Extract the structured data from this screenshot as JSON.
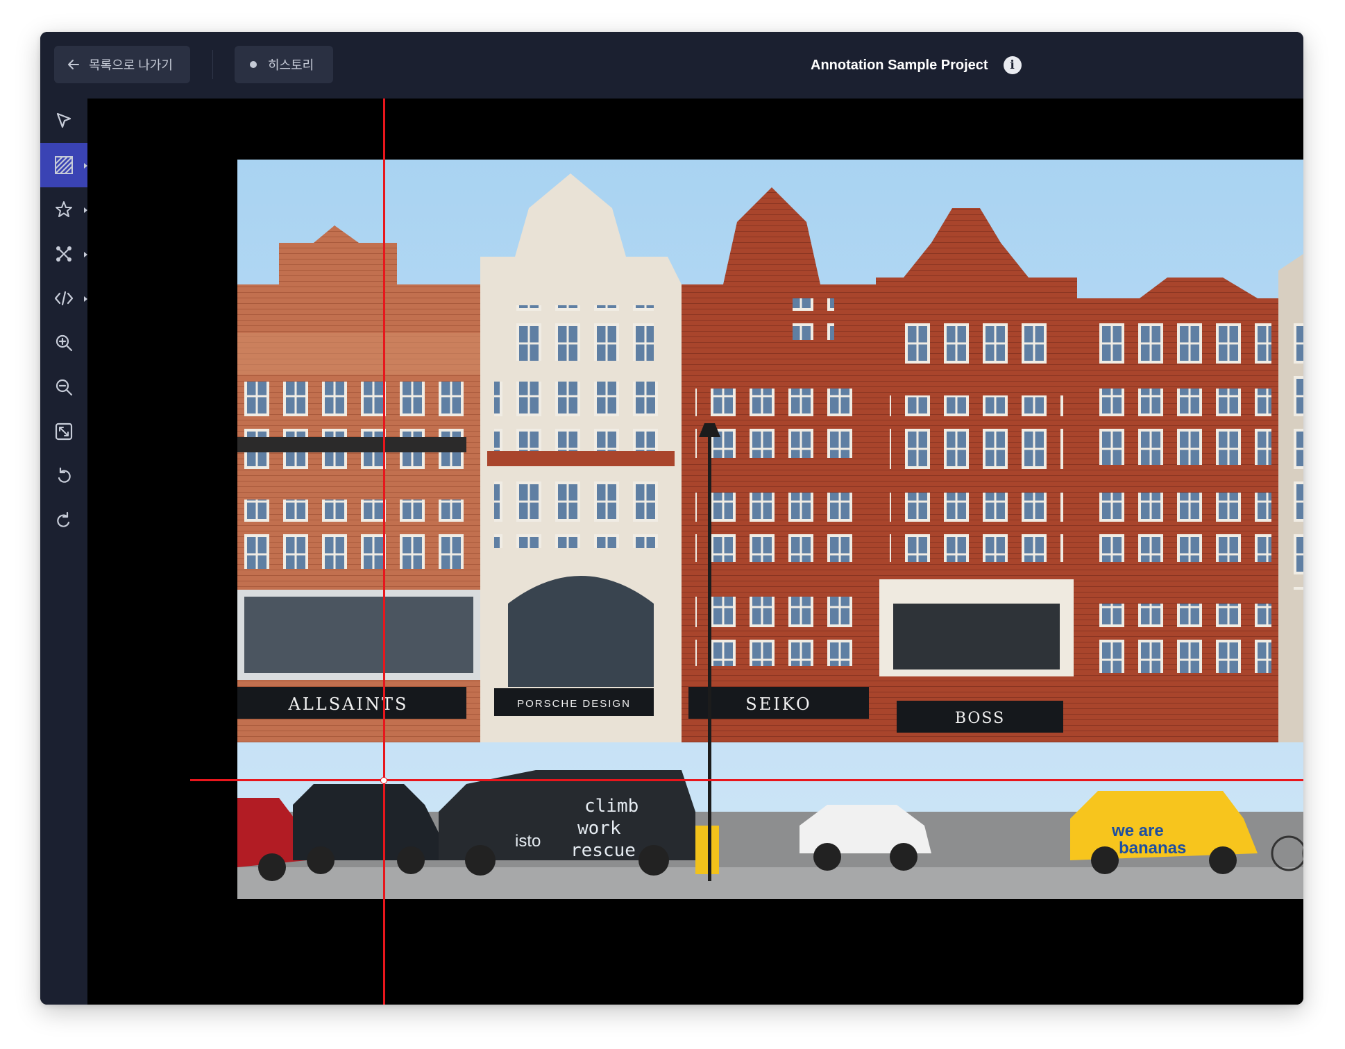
{
  "topbar": {
    "back_label": "목록으로 나가기",
    "history_label": "히스토리",
    "project_title": "Annotation Sample Project",
    "info_icon": "info-icon"
  },
  "toolbar": {
    "tools": [
      {
        "name": "select-tool",
        "icon": "cursor-arrow-icon",
        "active": false,
        "has_submenu": false
      },
      {
        "name": "area-tool",
        "icon": "hatched-box-icon",
        "active": true,
        "has_submenu": true
      },
      {
        "name": "polygon-tool",
        "icon": "star-icon",
        "active": false,
        "has_submenu": true
      },
      {
        "name": "keypoint-tool",
        "icon": "skeleton-icon",
        "active": false,
        "has_submenu": true
      },
      {
        "name": "code-tool",
        "icon": "code-icon",
        "active": false,
        "has_submenu": true
      },
      {
        "name": "zoom-in-tool",
        "icon": "zoom-in-icon",
        "active": false,
        "has_submenu": false
      },
      {
        "name": "zoom-out-tool",
        "icon": "zoom-out-icon",
        "active": false,
        "has_submenu": false
      },
      {
        "name": "fit-screen-tool",
        "icon": "fit-screen-icon",
        "active": false,
        "has_submenu": false
      },
      {
        "name": "undo-tool",
        "icon": "undo-icon",
        "active": false,
        "has_submenu": false
      },
      {
        "name": "redo-tool",
        "icon": "redo-icon",
        "active": false,
        "has_submenu": false
      }
    ]
  },
  "image": {
    "storefronts": [
      "ALLSAINTS",
      "PORSCHE DESIGN",
      "SEIKO",
      "BOSS"
    ],
    "van_text": [
      "climb",
      "work",
      "rescue",
      "isto"
    ],
    "taxi_text": [
      "we are",
      "bananas"
    ]
  },
  "colors": {
    "topbar": "#1b2030",
    "button": "#2a3042",
    "active_tool": "#3a43b4",
    "crosshair": "#e8161c"
  }
}
